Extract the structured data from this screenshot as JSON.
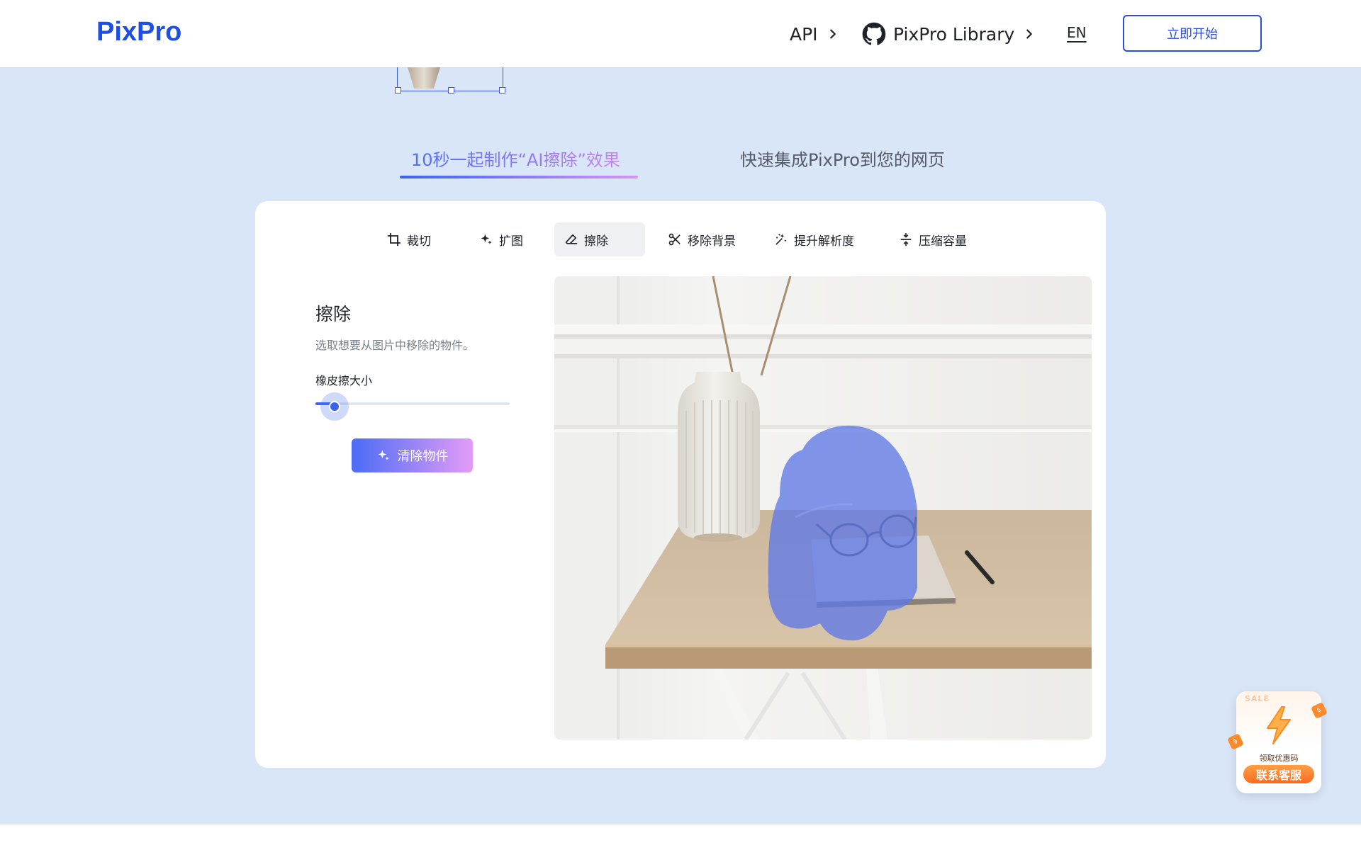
{
  "header": {
    "logo": "PixPro",
    "nav": [
      {
        "label": "API"
      },
      {
        "label": "PixPro Library"
      }
    ],
    "lang": "EN",
    "cta": "立即开始"
  },
  "section_tabs": [
    {
      "label": "10秒一起制作“AI擦除”效果",
      "active": true
    },
    {
      "label": "快速集成PixPro到您的网页",
      "active": false
    }
  ],
  "toolbar": [
    {
      "label": "裁切",
      "icon": "crop-icon"
    },
    {
      "label": "扩图",
      "icon": "sparkle-icon"
    },
    {
      "label": "擦除",
      "icon": "eraser-icon",
      "active": true
    },
    {
      "label": "移除背景",
      "icon": "scissors-icon"
    },
    {
      "label": "提升解析度",
      "icon": "enhance-icon"
    },
    {
      "label": "压缩容量",
      "icon": "compress-icon"
    }
  ],
  "panel": {
    "title": "擦除",
    "description": "选取想要从图片中移除的物件。",
    "slider_label": "橡皮擦大小",
    "slider_value": 0.1,
    "clear_button": "清除物件"
  },
  "sale_widget": {
    "tag": "SALE",
    "coupon": "领取优惠码",
    "contact": "联系客服"
  },
  "colors": {
    "brand": "#1d4fe6",
    "page_bg": "#d9e6f8",
    "accent_gradient_start": "#4b6cf5",
    "accent_gradient_end": "#e39cf7",
    "mask": "#5f78e6"
  }
}
